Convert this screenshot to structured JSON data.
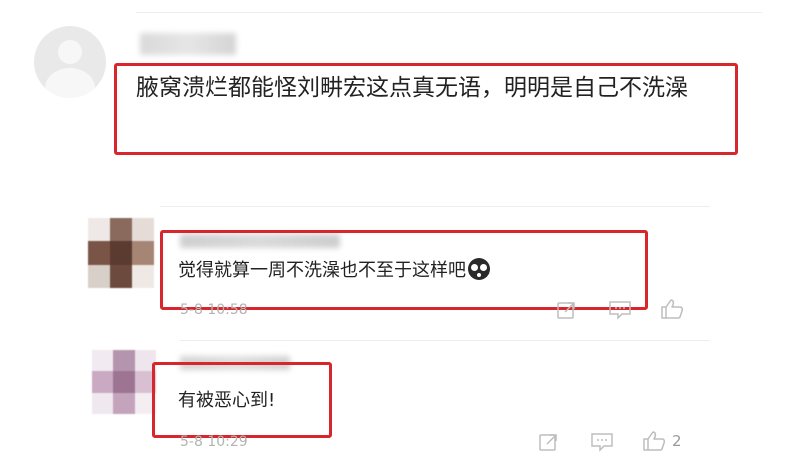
{
  "comments": [
    {
      "text": "腋窝溃烂都能怪刘畊宏这点真无语，明明是自己不洗澡"
    },
    {
      "text": "觉得就算一周不洗澡也不至于这样吧",
      "time": "5-8 10:58"
    },
    {
      "text": "有被恶心到!",
      "time": "5-8 10:29",
      "like_count": "2"
    }
  ],
  "icons": [
    "share-icon",
    "reply-icon",
    "like-icon",
    "emoji-icon"
  ]
}
